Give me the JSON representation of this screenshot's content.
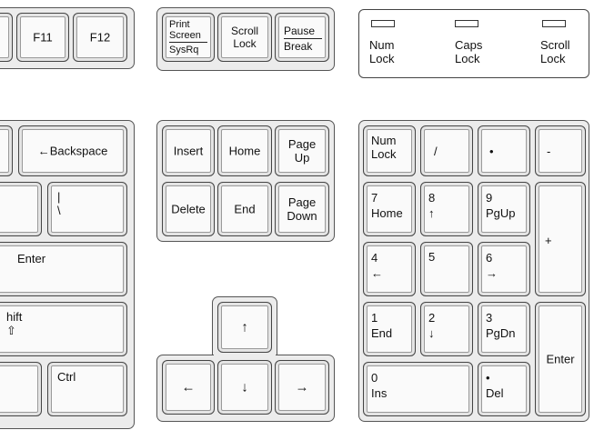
{
  "function_keys": {
    "f11": "F11",
    "f12": "F12"
  },
  "system_keys": {
    "print_screen_top": "Print\nScreen",
    "print_screen_bottom": "SysRq",
    "scroll_lock": "Scroll\nLock",
    "pause_top": "Pause",
    "pause_bottom": "Break"
  },
  "indicators": {
    "num_lock": "Num\nLock",
    "caps_lock": "Caps\nLock",
    "scroll_lock": "Scroll\nLock"
  },
  "main_keys": {
    "backspace": "←Backspace",
    "backslash": "|\n\\",
    "enter": "Enter",
    "shift": "hift\n⇧",
    "ctrl": "Ctrl"
  },
  "edit_keys": {
    "insert": "Insert",
    "home": "Home",
    "page_up": "Page\nUp",
    "delete": "Delete",
    "end": "End",
    "page_down": "Page\nDown"
  },
  "arrow_keys": {
    "up": "↑",
    "left": "←",
    "down": "↓",
    "right": "→"
  },
  "numpad": {
    "num_lock": "Num\nLock",
    "divide": "/",
    "multiply": "•",
    "minus": "-",
    "seven": "7\nHome",
    "eight": "8\n↑",
    "nine": "9\nPgUp",
    "plus": "+",
    "four": "4\n←",
    "five": "5",
    "six": "6\n→",
    "one": "1\nEnd",
    "two": "2\n↓",
    "three": "3\nPgDn",
    "enter": "Enter",
    "zero": "0\nIns",
    "decimal": "•\nDel"
  }
}
